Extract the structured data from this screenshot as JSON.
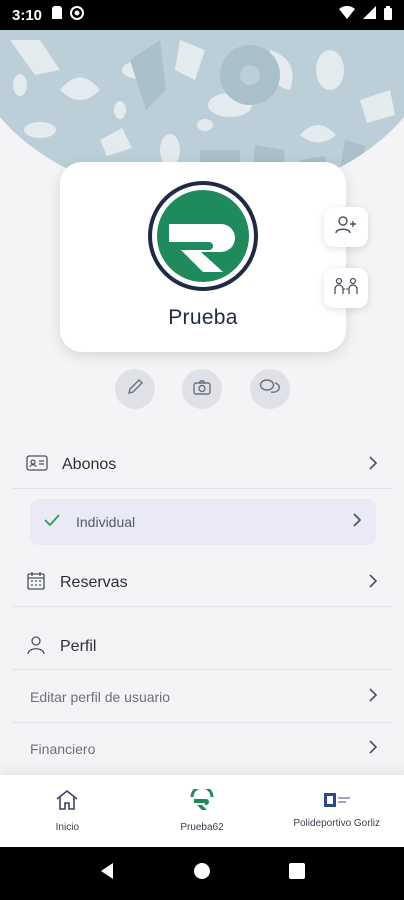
{
  "status_bar": {
    "time": "3:10"
  },
  "profile": {
    "name": "Prueba"
  },
  "menu": {
    "abonos": "Abonos",
    "individual": "Individual",
    "reservas": "Reservas",
    "perfil": "Perfil",
    "editar_perfil": "Editar perfil de usuario",
    "financiero": "Financiero"
  },
  "bottom_nav": [
    {
      "label": "Inicio",
      "icon": "home-icon"
    },
    {
      "label": "Prueba62",
      "icon": "app-logo-icon"
    },
    {
      "label": "Polideportivo Gorliz",
      "icon": "center-logo-icon"
    }
  ],
  "colors": {
    "brand_green": "#1f8a5b",
    "brand_navy": "#1f2a44",
    "check_green": "#2e9e55"
  }
}
